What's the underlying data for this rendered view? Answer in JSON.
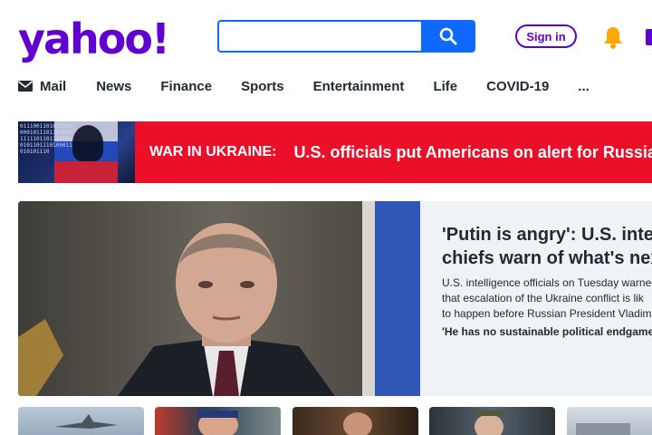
{
  "header": {
    "logo_text": "yahoo!",
    "search": {
      "value": "",
      "placeholder": ""
    },
    "signin_label": "Sign in"
  },
  "nav": {
    "items": [
      {
        "label": "Mail",
        "icon": "mail-icon"
      },
      {
        "label": "News"
      },
      {
        "label": "Finance"
      },
      {
        "label": "Sports"
      },
      {
        "label": "Entertainment"
      },
      {
        "label": "Life"
      },
      {
        "label": "COVID-19"
      },
      {
        "label": "..."
      }
    ]
  },
  "banner": {
    "label": "WAR IN UKRAINE:",
    "headline": "U.S. officials put Americans on alert for Russian",
    "thumb_code_text": "0111001101011100000101110110101011111011011100010101101110100011010101110"
  },
  "hero": {
    "title": "'Putin is angry': U.S. intel\nchiefs warn of what's nex",
    "summary": "U.S. intelligence officials on Tuesday warned\nthat escalation of the Ukraine conflict is lik\nto happen before Russian President Vladim",
    "link": "'He has no sustainable political endgame' »"
  },
  "colors": {
    "brand": "#6001d2",
    "search_blue": "#0f69ff",
    "banner_red": "#eb0f29",
    "bell": "#ffa700"
  }
}
